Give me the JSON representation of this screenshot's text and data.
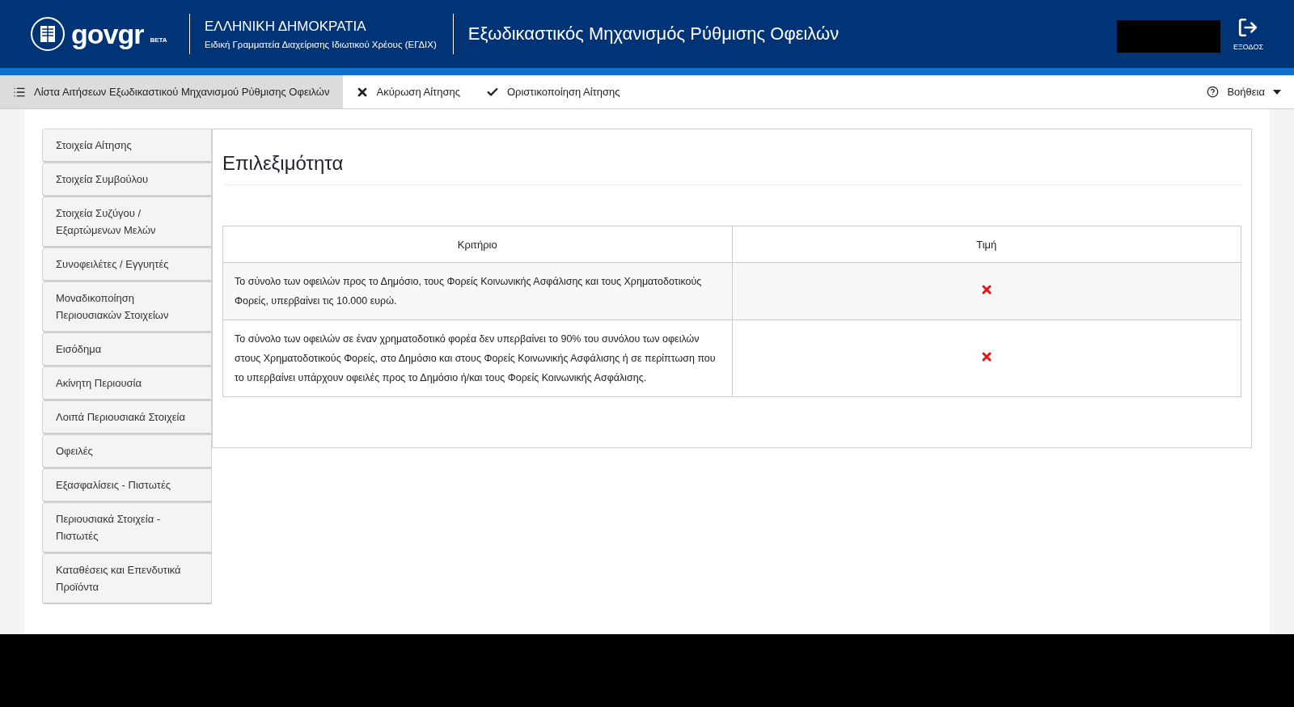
{
  "header": {
    "logo": "govgr",
    "logo_badge": "BETA",
    "org_title": "ΕΛΛΗΝΙΚΗ ΔΗΜΟΚΡΑΤΙΑ",
    "org_subtitle": "Ειδική Γραμματεία Διαχείρισης Ιδιωτικού Χρέους (ΕΓΔΙΧ)",
    "app_title": "Εξωδικαστικός Μηχανισμός Ρύθμισης Οφειλών",
    "logout": "ΕΞΟΔΟΣ"
  },
  "toolbar": {
    "items": [
      {
        "label": "Λίστα Αιτήσεων Εξωδικαστικού Μηχανισμού Ρύθμισης Οφειλών",
        "kind": "list",
        "selected": true
      },
      {
        "label": "Ακύρωση Αίτησης",
        "kind": "cancel",
        "selected": false
      },
      {
        "label": "Οριστικοποίηση Αίτησης",
        "kind": "confirm",
        "selected": false
      }
    ],
    "help": "Βοήθεια"
  },
  "sidebar": {
    "items": [
      {
        "label": "Στοιχεία Αίτησης"
      },
      {
        "label": "Στοιχεία Συμβούλου"
      },
      {
        "label": "Στοιχεία Συζύγου / Εξαρτώμενων Μελών"
      },
      {
        "label": "Συνοφειλέτες / Εγγυητές"
      },
      {
        "label": "Μοναδικοποίηση Περιουσιακών Στοιχείων"
      },
      {
        "label": "Εισόδημα"
      },
      {
        "label": "Ακίνητη Περιουσία"
      },
      {
        "label": "Λοιπά Περιουσιακά Στοιχεία"
      },
      {
        "label": "Οφειλές"
      },
      {
        "label": "Εξασφαλίσεις - Πιστωτές"
      },
      {
        "label": "Περιουσιακά Στοιχεία - Πιστωτές"
      },
      {
        "label": "Καταθέσεις και Επενδυτικά Προϊόντα"
      }
    ]
  },
  "panel": {
    "title": "Επιλεξιμότητα",
    "table": {
      "columns": [
        "Κριτήριο",
        "Τιμή"
      ],
      "rows": [
        {
          "criterion": "Το σύνολο των οφειλών προς το Δημόσιο, τους Φορείς Κοινωνικής Ασφάλισης και τους Χρηματοδοτικούς Φορείς, υπερβαίνει τις 10.000 ευρώ.",
          "met": false
        },
        {
          "criterion": "Το σύνολο των οφειλών σε έναν χρηματοδοτικό φορέα δεν υπερβαίνει το 90% του συνόλου των οφειλών στους Χρηματοδοτικούς Φορείς, στο Δημόσιο και στους Φορείς Κοινωνικής Ασφάλισης ή σε περίπτωση που το υπερβαίνει υπάρχουν οφειλές προς το Δημόσιο ή/και τους Φορείς Κοινωνικής Ασφάλισης.",
          "met": false
        }
      ]
    }
  }
}
